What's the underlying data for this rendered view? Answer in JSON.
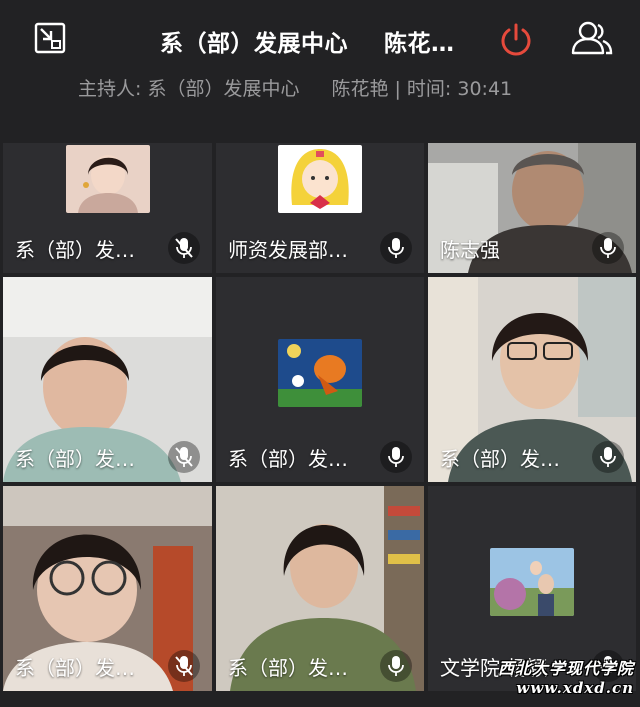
{
  "header": {
    "title_meeting": "系（部）发展中心",
    "title_user": "陈花…",
    "host_label": "主持人: 系（部）发展中心",
    "host_extra": "陈花艳 | 时间: 30:41",
    "icons": {
      "shrink": "shrink-window-icon",
      "end": "power-icon",
      "participants": "participants-icon"
    },
    "colors": {
      "end_button": "#e64a3c",
      "background": "#222224",
      "subtitle": "#9a9a9c"
    }
  },
  "participants": [
    {
      "name": "系（部）发…",
      "mic": "muted",
      "kind": "avatar"
    },
    {
      "name": "师资发展部…",
      "mic": "on",
      "kind": "avatar"
    },
    {
      "name": "陈志强",
      "mic": "on",
      "kind": "video"
    },
    {
      "name": "系（部）发…",
      "mic": "muted",
      "kind": "video"
    },
    {
      "name": "系（部）发…",
      "mic": "on",
      "kind": "avatar"
    },
    {
      "name": "系（部）发…",
      "mic": "on",
      "kind": "video"
    },
    {
      "name": "系（部）发…",
      "mic": "muted",
      "kind": "video"
    },
    {
      "name": "系（部）发…",
      "mic": "on",
      "kind": "video"
    },
    {
      "name": "文学院-杨颖",
      "mic": "on",
      "kind": "avatar"
    }
  ],
  "watermark": {
    "name": "西北大学现代学院",
    "url": "www.xdxd.cn"
  }
}
